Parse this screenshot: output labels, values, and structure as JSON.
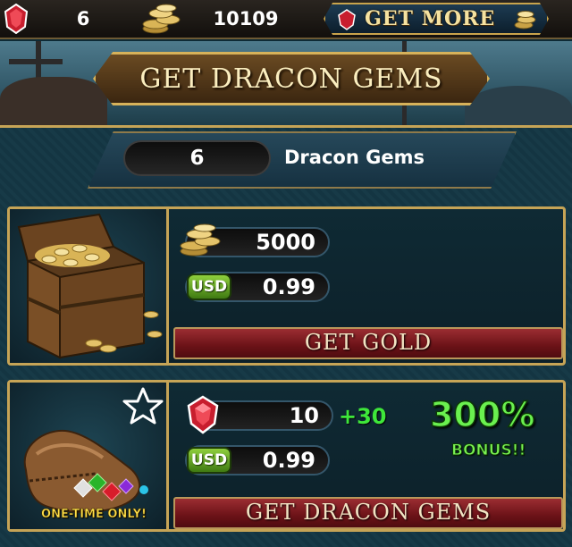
{
  "topbar": {
    "gems": "6",
    "gold": "10109",
    "get_more_label": "GET MORE",
    "gem_icon": "ruby-gem-icon",
    "coin_icon": "gold-coins-icon"
  },
  "banner": {
    "title": "GET DRACON GEMS"
  },
  "balance": {
    "value": "6",
    "label": "Dracon Gems"
  },
  "offers": [
    {
      "art": "treasure-chest-icon",
      "amount": "5000",
      "amount_icon": "gold-coins-icon",
      "currency": "USD",
      "price": "0.99",
      "button_label": "GET GOLD"
    },
    {
      "art": "gem-pouch-icon",
      "amount": "10",
      "amount_icon": "ruby-gem-icon",
      "bonus_amount": "+30",
      "bonus_percent": "300%",
      "bonus_label": "BONUS!!",
      "currency": "USD",
      "price": "0.99",
      "badge": "ONE-TIME ONLY!",
      "favorite_icon": "star-outline-icon",
      "button_label": "GET DRACON GEMS"
    }
  ],
  "colors": {
    "gold_trim": "#c6a456",
    "panel_bg": "#173a47",
    "button_red": "#6b1217",
    "bonus_green": "#6af04f",
    "usd_green": "#5fa324"
  }
}
